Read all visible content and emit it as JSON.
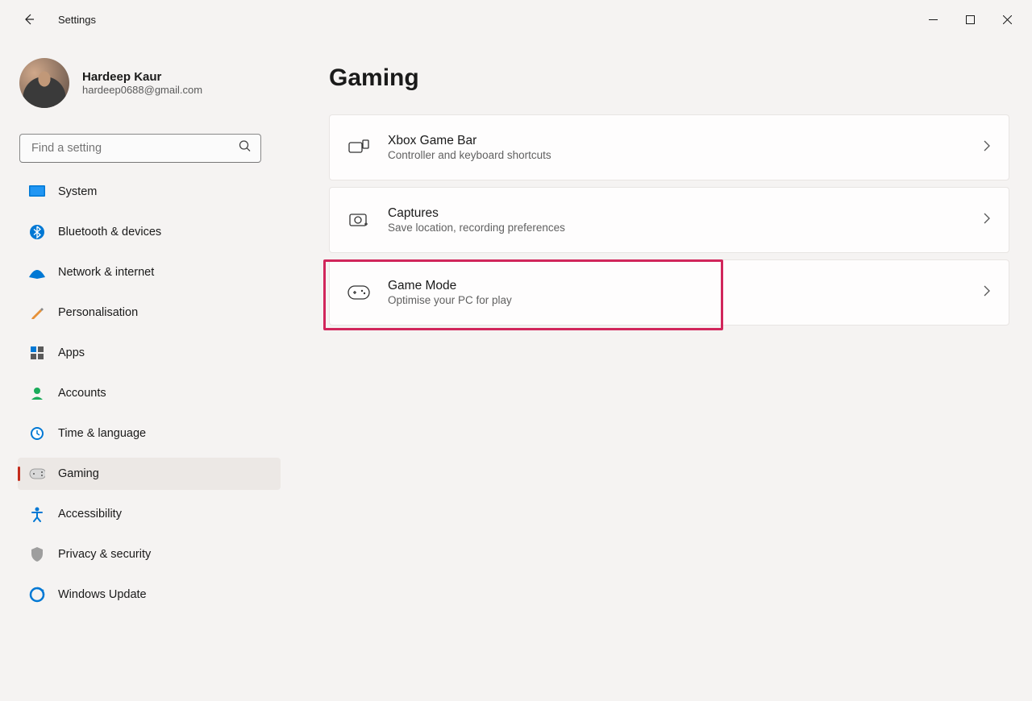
{
  "app": {
    "title": "Settings"
  },
  "profile": {
    "name": "Hardeep Kaur",
    "email": "hardeep0688@gmail.com"
  },
  "search": {
    "placeholder": "Find a setting"
  },
  "nav": {
    "items": [
      {
        "icon": "system",
        "label": "System"
      },
      {
        "icon": "bluetooth",
        "label": "Bluetooth & devices"
      },
      {
        "icon": "network",
        "label": "Network & internet"
      },
      {
        "icon": "personalisation",
        "label": "Personalisation"
      },
      {
        "icon": "apps",
        "label": "Apps"
      },
      {
        "icon": "accounts",
        "label": "Accounts"
      },
      {
        "icon": "time",
        "label": "Time & language"
      },
      {
        "icon": "gaming",
        "label": "Gaming"
      },
      {
        "icon": "accessibility",
        "label": "Accessibility"
      },
      {
        "icon": "privacy",
        "label": "Privacy & security"
      },
      {
        "icon": "update",
        "label": "Windows Update"
      }
    ],
    "active_index": 7
  },
  "page": {
    "title": "Gaming"
  },
  "cards": [
    {
      "title": "Xbox Game Bar",
      "subtitle": "Controller and keyboard shortcuts",
      "icon": "xbox"
    },
    {
      "title": "Captures",
      "subtitle": "Save location, recording preferences",
      "icon": "captures"
    },
    {
      "title": "Game Mode",
      "subtitle": "Optimise your PC for play",
      "icon": "gamemode",
      "highlighted": true
    }
  ]
}
